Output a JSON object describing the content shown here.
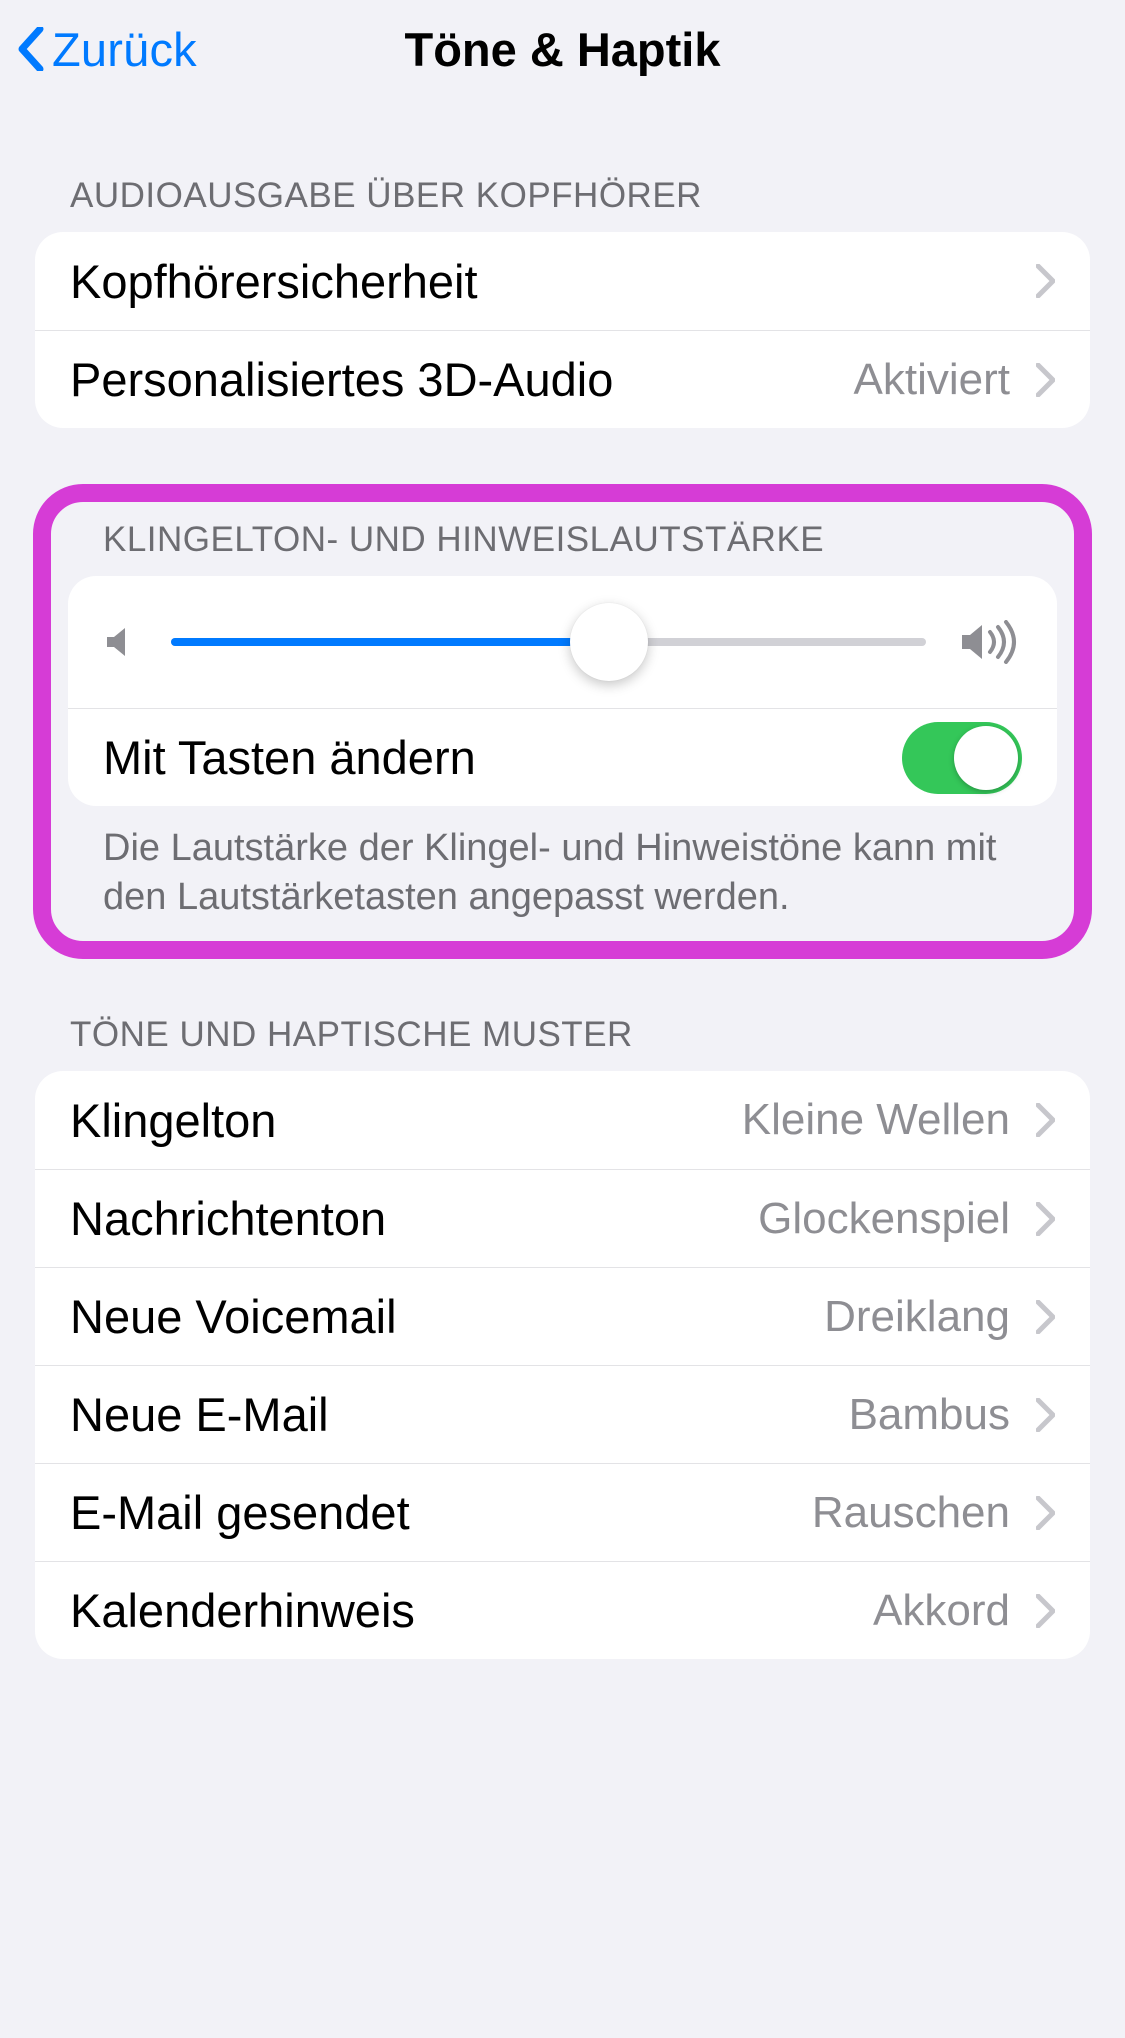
{
  "nav": {
    "back": "Zurück",
    "title": "Töne & Haptik"
  },
  "sections": {
    "headphones": {
      "header": "Audioausgabe über Kopfhörer",
      "safety": "Kopfhörersicherheit",
      "spatial": {
        "label": "Personalisiertes 3D-Audio",
        "value": "Aktiviert"
      }
    },
    "ringer": {
      "header": "Klingelton- und Hinweislautstärke",
      "slider_percent": 58,
      "change_with_buttons": {
        "label": "Mit Tasten ändern",
        "on": true
      },
      "footer": "Die Lautstärke der Klingel- und Hinweistöne kann mit den Lautstärketasten angepasst werden."
    },
    "patterns": {
      "header": "Töne und haptische Muster",
      "rows": [
        {
          "label": "Klingelton",
          "value": "Kleine Wellen"
        },
        {
          "label": "Nachrichtenton",
          "value": "Glockenspiel"
        },
        {
          "label": "Neue Voicemail",
          "value": "Dreiklang"
        },
        {
          "label": "Neue E-Mail",
          "value": "Bambus"
        },
        {
          "label": "E-Mail gesendet",
          "value": "Rauschen"
        },
        {
          "label": "Kalenderhinweis",
          "value": "Akkord"
        }
      ]
    }
  },
  "colors": {
    "accent": "#007aff",
    "toggle_on": "#34c759",
    "highlight": "#d63cd6"
  }
}
